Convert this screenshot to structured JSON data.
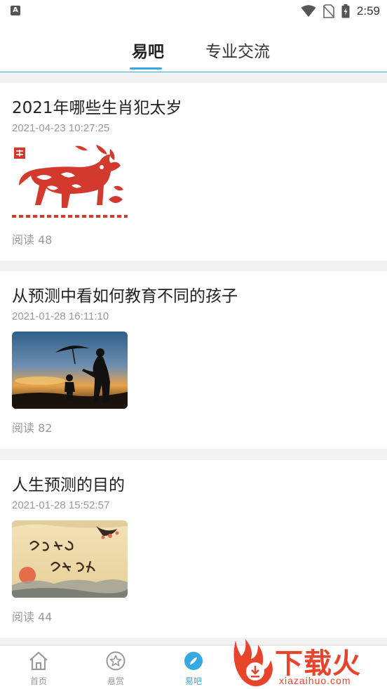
{
  "status_bar": {
    "left_icon_letter": "A",
    "time": "2:59",
    "icons": [
      "wifi-icon",
      "no-sim-icon",
      "battery-icon"
    ]
  },
  "tabs": [
    {
      "label": "易吧",
      "active": true
    },
    {
      "label": "专业交流",
      "active": false
    }
  ],
  "posts": [
    {
      "title": "2021年哪些生肖犯太岁",
      "date": "2021-04-23 10:27:25",
      "reads": "阅读 48",
      "image": "papercut-ox-image"
    },
    {
      "title": "从预测中看如何教育不同的孩子",
      "date": "2021-01-28 16:11:10",
      "reads": "阅读 82",
      "image": "parent-child-sunset-image"
    },
    {
      "title": "人生预测的目的",
      "date": "2021-01-28 15:52:57",
      "reads": "阅读 44",
      "image": "calligraphy-landscape-image"
    }
  ],
  "bottom_nav": [
    {
      "label": "首页",
      "icon": "home-icon",
      "active": false
    },
    {
      "label": "悬赏",
      "icon": "star-icon",
      "active": false
    },
    {
      "label": "易吧",
      "icon": "compass-icon",
      "active": true
    }
  ],
  "colors": {
    "accent": "#36a9e1",
    "watermark": "#e8432b"
  },
  "watermark": {
    "title": "下载火",
    "domain": "xiazaihuo.com"
  }
}
